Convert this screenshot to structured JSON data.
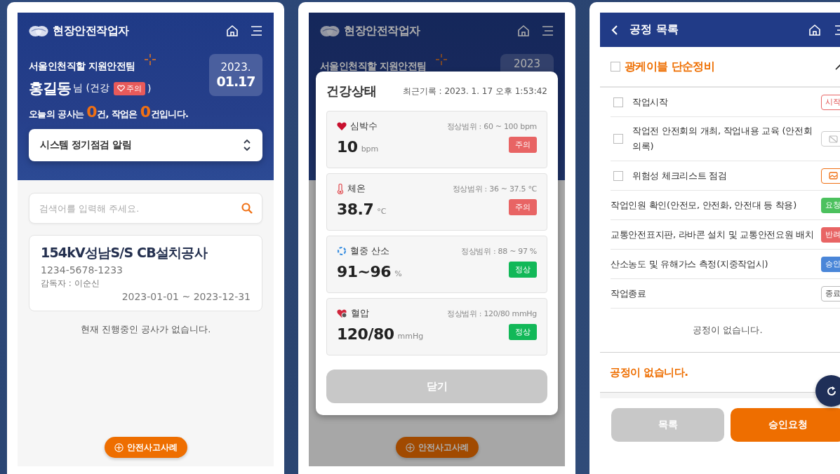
{
  "home_screen": {
    "app_title": "현장안전작업자",
    "team": "서울인천직할 지원안전팀",
    "user_name": "홍길동",
    "name_suffix": "님 (건강",
    "health_badge": "주의",
    "close_paren": ")",
    "date_year": "2023.",
    "date_day": "01.17",
    "summary": [
      {
        "text": "오늘의 공사는 ",
        "highlight": false
      },
      {
        "text": "0",
        "highlight": true
      },
      {
        "text": "건, 작업은 ",
        "highlight": false
      },
      {
        "text": "0",
        "highlight": true
      },
      {
        "text": "건입니다.",
        "highlight": false
      }
    ],
    "notice": "시스템 정기점검 알림",
    "search": {
      "placeholder": "검색어를 입력해 주세요."
    },
    "project": {
      "title": "154kV성남S/S CB설치공사",
      "code": "1234-5678-1233",
      "supervisor": "감독자 : 이순신",
      "period": "2023-01-01 ~ 2023-12-31"
    },
    "empty_message": "현재 진행중인 공사가 없습니다.",
    "fab_button": "안전사고사례"
  },
  "health_screen": {
    "app_title": "현장안전작업자",
    "team": "서울인천직할 지원안전팀",
    "date_year": "2023",
    "fab_button": "안전사고사례",
    "modal": {
      "title": "건강상태",
      "last_record": "최근기록 : 2023. 1. 17 오후 1:53:42",
      "metrics": [
        {
          "kind": "heart",
          "name": "심박수",
          "range": "정상범위 : 60 ~ 100 bpm",
          "value": "10",
          "unit": "bpm",
          "status": "주의",
          "normal": false
        },
        {
          "kind": "thermometer",
          "name": "체온",
          "range": "정상범위 : 36 ~ 37.5 °C",
          "value": "38.7",
          "unit": "°C",
          "status": "주의",
          "normal": false
        },
        {
          "kind": "oxygen",
          "name": "혈중 산소",
          "range": "정상범위 : 88 ~ 97 %",
          "value": "91~96",
          "unit": "%",
          "status": "정상",
          "normal": true
        },
        {
          "kind": "pressure",
          "name": "혈압",
          "range": "정상범위 : 120/80 mmHg",
          "value": "120/80",
          "unit": "mmHg",
          "status": "정상",
          "normal": true
        }
      ],
      "close_button": "닫기"
    }
  },
  "process_screen": {
    "title": "공정 목록",
    "group": {
      "name": "광케이블 단순정비",
      "checked": false,
      "expanded": true
    },
    "steps": [
      {
        "kind": "check",
        "label": "작업시작",
        "checked": false,
        "badge": {
          "kind": "outline-red",
          "text": "시작"
        }
      },
      {
        "kind": "check",
        "label": "작업전 안전회의 개최, 작업내용 교육 (안전회의록)",
        "checked": false,
        "badge": {
          "kind": "no-image"
        }
      },
      {
        "kind": "check",
        "label": "위험성 체크리스트 점검",
        "checked": false,
        "badge": {
          "kind": "image"
        }
      },
      {
        "kind": "plain",
        "label": "작업인원 확인(안전모, 안전화, 안전대 등 착용)",
        "badge": {
          "kind": "green",
          "text": "요청"
        }
      },
      {
        "kind": "plain",
        "label": "교통안전표지판, 라바콘 설치 및 교통안전요원 배치",
        "badge": {
          "kind": "red",
          "text": "반려"
        }
      },
      {
        "kind": "plain",
        "label": "산소농도 및 유해가스 측정(지중작업시)",
        "badge": {
          "kind": "blue",
          "text": "승인"
        }
      },
      {
        "kind": "plain",
        "label": "작업종료",
        "badge": {
          "kind": "outline-grey",
          "text": "종료"
        }
      }
    ],
    "empty_inner": "공정이 없습니다.",
    "empty_outer": "공정이 없습니다.",
    "list_button": "목록",
    "approve_button": "승인요청"
  }
}
